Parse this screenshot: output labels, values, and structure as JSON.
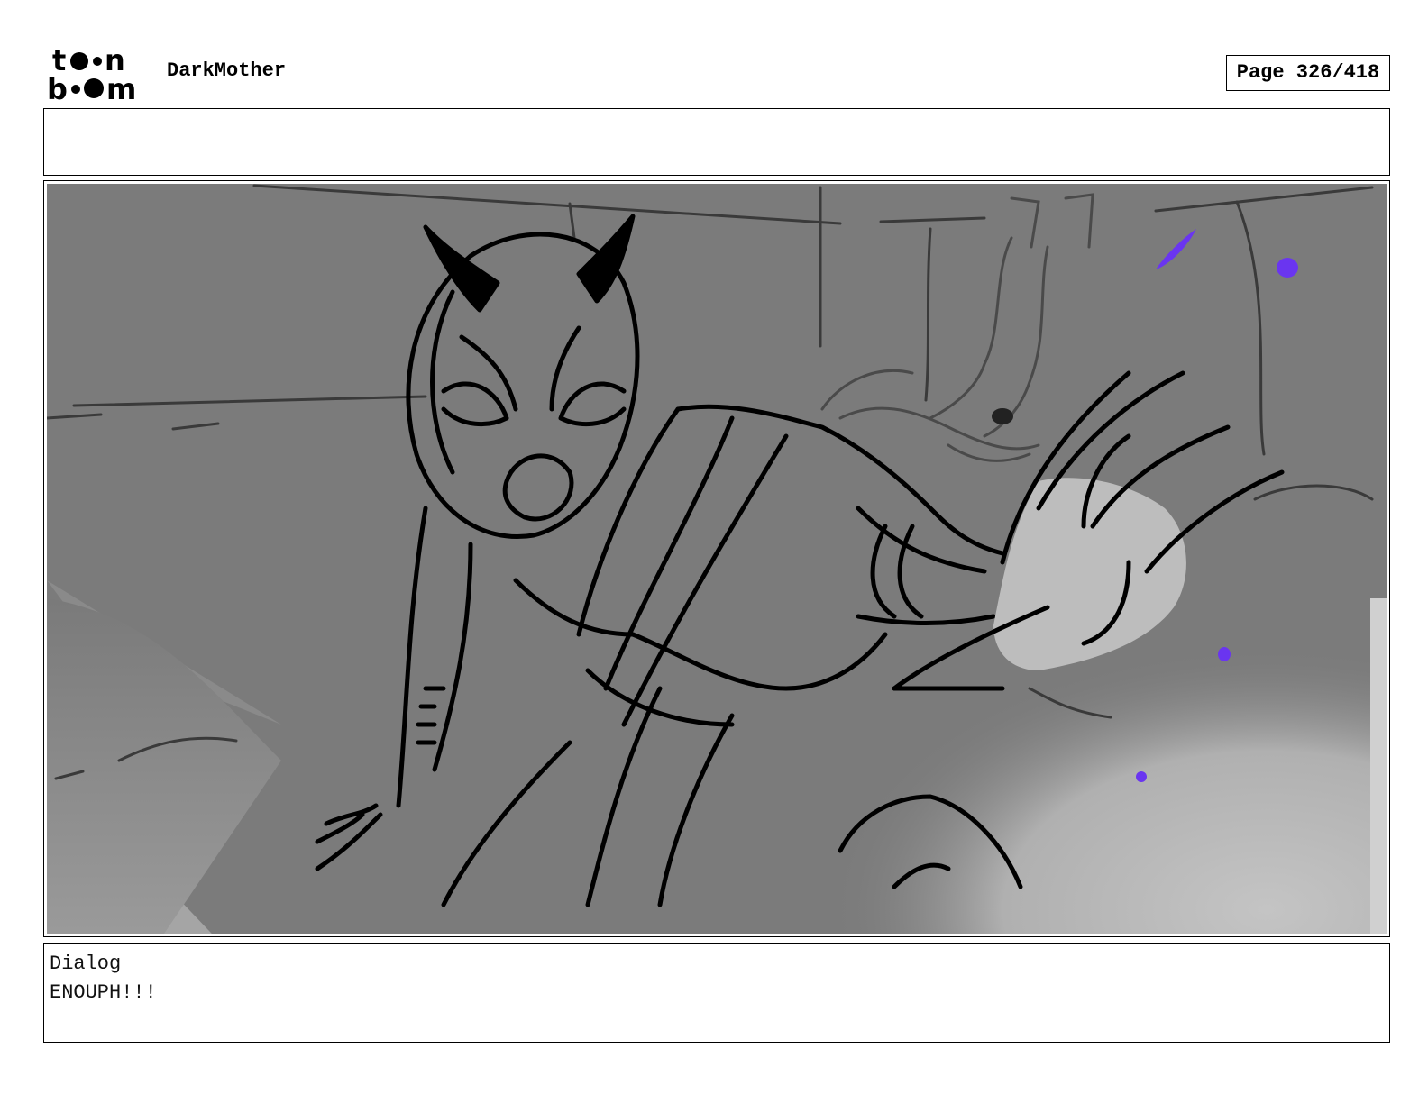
{
  "header": {
    "brand_top": "toon",
    "brand_bottom": "boom",
    "project_title": "DarkMother",
    "page_indicator": "Page 326/418"
  },
  "notes": {
    "text": ""
  },
  "panel": {
    "image_icon": "storyboard-sketch-image",
    "colors": {
      "background": "#7a7a7a",
      "floor_light": "#c0c0c0",
      "accent_spark": "#6a35f0"
    }
  },
  "dialog": {
    "label": "Dialog",
    "text": "ENOUPH!!!"
  }
}
